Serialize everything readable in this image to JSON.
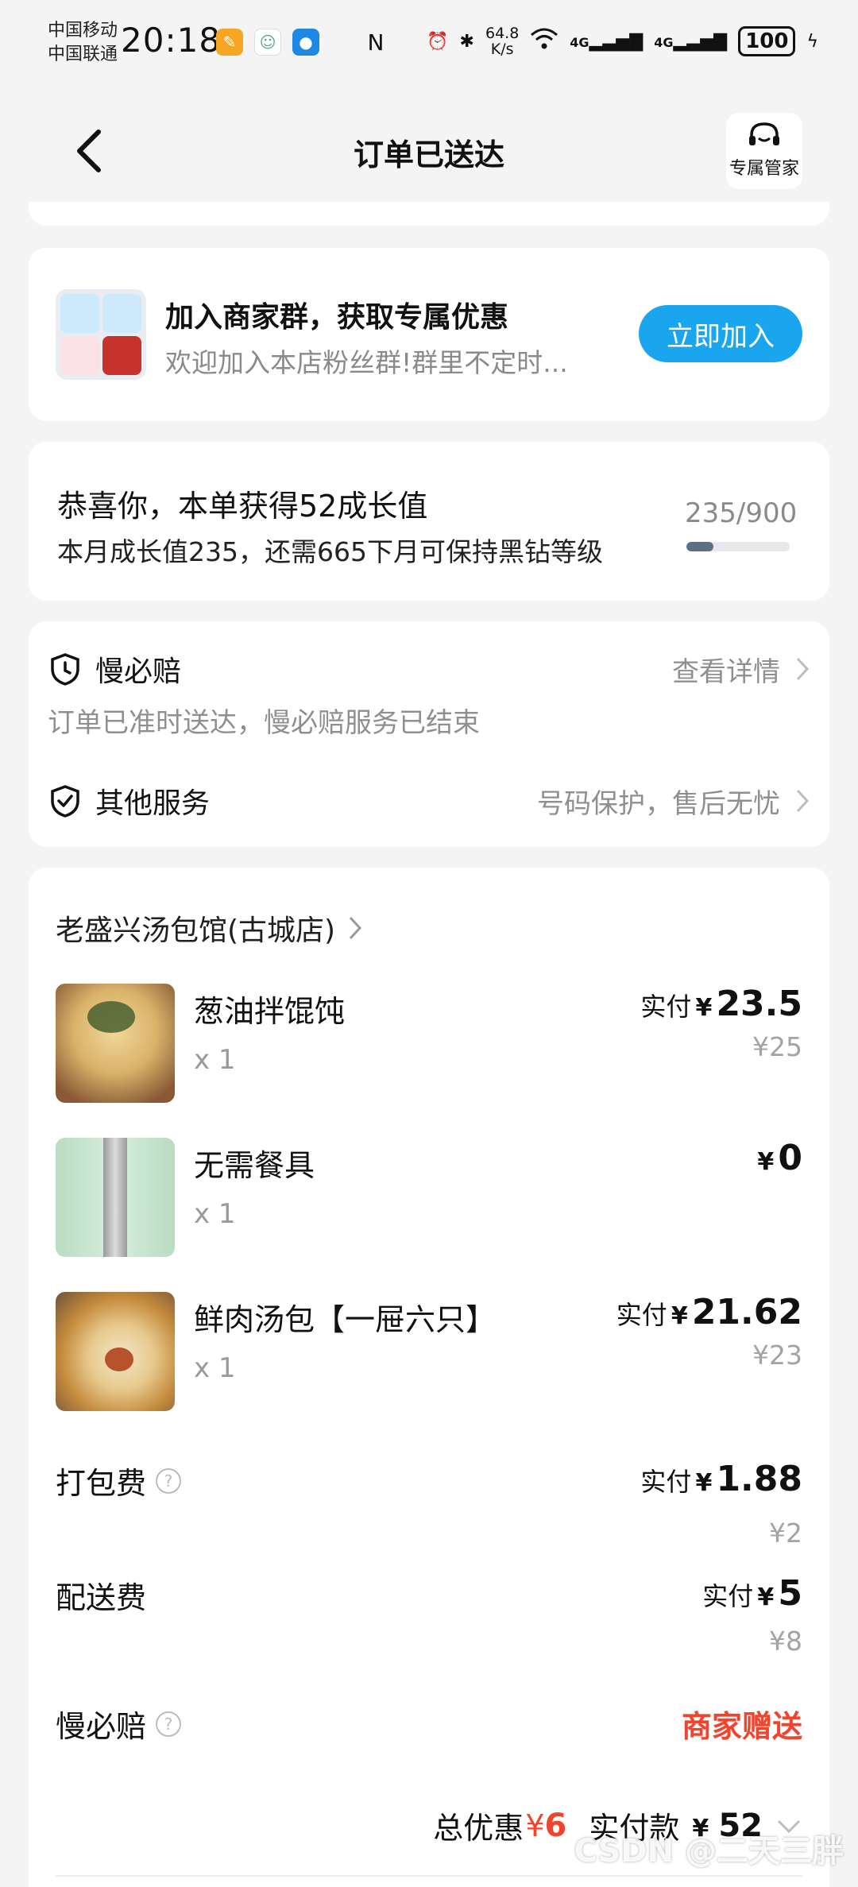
{
  "status_bar": {
    "carrier_1": "中国移动",
    "carrier_2": "中国联通",
    "time": "20:18",
    "speed_value": "64.8",
    "speed_unit": "K/s",
    "net_1": "4G",
    "net_2": "4G",
    "battery": "100"
  },
  "header": {
    "title": "订单已送达",
    "butler_label": "专属管家"
  },
  "merchant_group": {
    "title": "加入商家群，获取专属优惠",
    "subtitle": "欢迎加入本店粉丝群!群里不定时...",
    "join_label": "立即加入"
  },
  "growth": {
    "title": "恭喜你，本单获得52成长值",
    "subtitle": "本月成长值235，还需665下月可保持黑钻等级",
    "progress_text": "235/900",
    "progress_fraction": 0.261
  },
  "services": {
    "slow_compensation": {
      "name": "慢必赔",
      "link": "查看详情",
      "note": "订单已准时送达，慢必赔服务已结束"
    },
    "other": {
      "name": "其他服务",
      "detail": "号码保护，售后无忧"
    }
  },
  "order": {
    "store_name": "老盛兴汤包馆(古城店)",
    "items": [
      {
        "name": "葱油拌馄饨",
        "qty": "x 1",
        "paid_label": "实付",
        "currency": "¥",
        "paid": "23.5",
        "original": "¥25"
      },
      {
        "name": "无需餐具",
        "qty": "x 1",
        "paid_label": "",
        "currency": "¥",
        "paid": "0",
        "original": ""
      },
      {
        "name": "鲜肉汤包【一屉六只】",
        "qty": "x 1",
        "paid_label": "实付",
        "currency": "¥",
        "paid": "21.62",
        "original": "¥23"
      }
    ],
    "fees": {
      "packing": {
        "name": "打包费",
        "help": "?",
        "paid_label": "实付",
        "currency": "¥",
        "paid": "1.88",
        "original": "¥2"
      },
      "delivery": {
        "name": "配送费",
        "paid_label": "实付",
        "currency": "¥",
        "paid": "5",
        "original": "¥8"
      },
      "slow_comp": {
        "name": "慢必赔",
        "help": "?",
        "value": "商家赠送"
      }
    },
    "summary": {
      "discount_label": "总优惠",
      "discount_currency": "¥",
      "discount_value": "6",
      "paid_label": "实付款",
      "paid_currency": "¥",
      "paid_value": "52"
    }
  },
  "watermark": "CSDN @二天三胖",
  "colors": {
    "accent_blue": "#1aa6ef",
    "red": "#f0442d",
    "progress": "#5f6e86"
  }
}
